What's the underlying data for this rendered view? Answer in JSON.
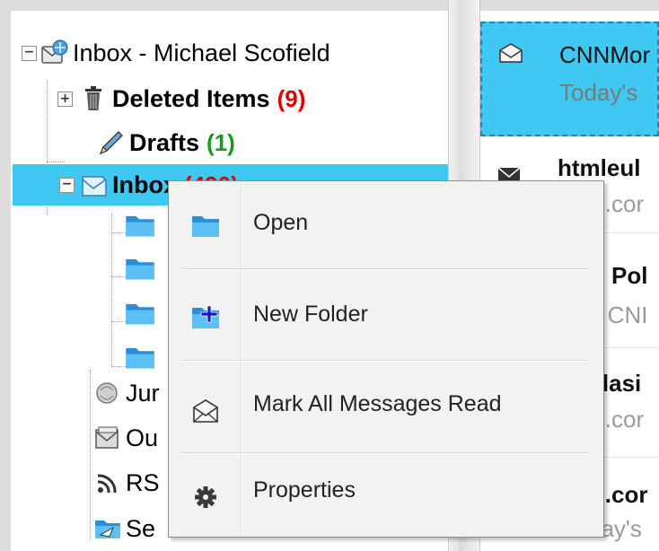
{
  "folder_tree": {
    "root": {
      "label": "Inbox - Michael Scofield",
      "expander": "⊟",
      "icon": "mailbox-icon"
    },
    "items": [
      {
        "label": "Deleted Items",
        "count": "(9)",
        "count_color": "#e00000",
        "expander": "+",
        "icon": "trash-icon"
      },
      {
        "label": "Drafts",
        "count": "(1)",
        "count_color": "#1a9a1a",
        "icon": "pencil-icon"
      },
      {
        "label": "Inbox",
        "count": "(490)",
        "count_color": "#e00000",
        "expander": "−",
        "icon": "inbox-envelope-icon",
        "selected": true
      },
      {
        "label": "Jur",
        "icon": "junk-icon"
      },
      {
        "label": "Ou",
        "icon": "outbox-icon"
      },
      {
        "label": "RS",
        "icon": "rss-icon"
      },
      {
        "label": "Se",
        "icon": "sent-icon"
      }
    ],
    "subfolder_icon": "folder-icon"
  },
  "messages": [
    {
      "sender": "CNNMor",
      "subject": "Today's",
      "icon": "envelope-open-icon",
      "selected": true
    },
    {
      "sender": "htmleul",
      "subject": "N.cor",
      "icon": "envelope-closed-icon"
    },
    {
      "sender": "N Pol",
      "subject": "e CNI"
    },
    {
      "sender": "nlasi",
      "subject": "N.cor"
    },
    {
      "sender": "N.cor",
      "subject": "day's"
    }
  ],
  "context_menu": {
    "items": [
      {
        "label": "Open",
        "icon": "folder-open-icon"
      },
      {
        "label": "New Folder",
        "icon": "new-folder-icon"
      },
      {
        "label": "Mark All Messages Read",
        "icon": "envelope-open-icon"
      },
      {
        "label": "Properties",
        "icon": "gear-icon"
      }
    ]
  },
  "colors": {
    "selection": "#3fc8f1",
    "folder_blue": "#3aa6e0",
    "count_red": "#e00000",
    "count_green": "#1a9a1a"
  }
}
